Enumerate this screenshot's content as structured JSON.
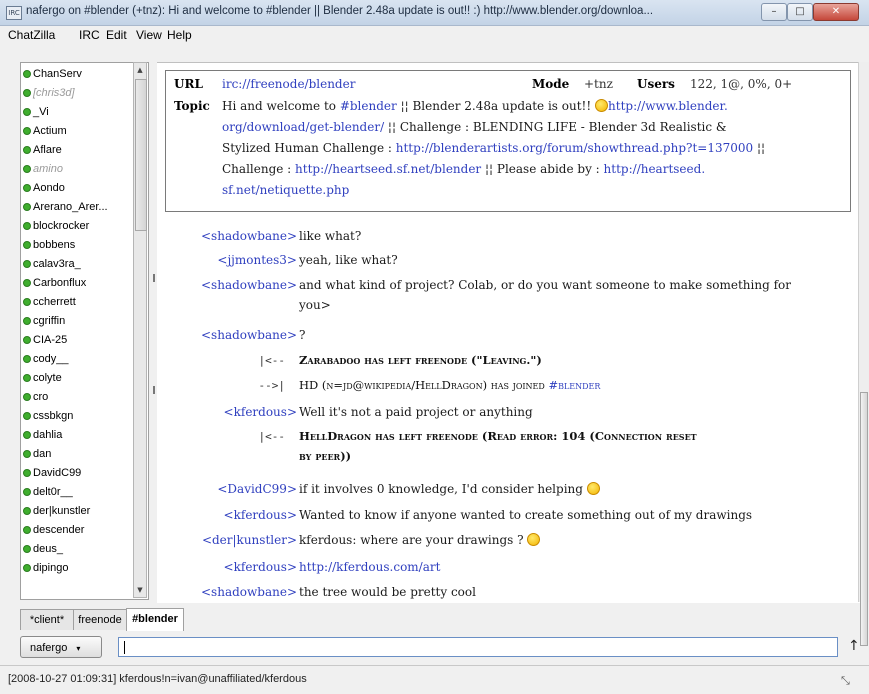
{
  "window": {
    "title": "nafergo on #blender (+tnz): Hi and welcome to #blender || Blender 2.48a update is out!! :) http://www.blender.org/downloa...",
    "app_icon_label": "IRC",
    "minimize": "–",
    "maximize": "□",
    "close": "✕"
  },
  "menu": [
    "ChatZilla",
    "IRC",
    "Edit",
    "View",
    "Help"
  ],
  "users": [
    {
      "name": "ChanServ",
      "away": false
    },
    {
      "name": "[chris3d]",
      "away": true
    },
    {
      "name": "_Vi",
      "away": false
    },
    {
      "name": "Actium",
      "away": false
    },
    {
      "name": "Aflare",
      "away": false
    },
    {
      "name": "amino",
      "away": true
    },
    {
      "name": "Aondo",
      "away": false
    },
    {
      "name": "Arerano_Arer...",
      "away": false
    },
    {
      "name": "blockrocker",
      "away": false
    },
    {
      "name": "bobbens",
      "away": false
    },
    {
      "name": "calav3ra_",
      "away": false
    },
    {
      "name": "Carbonflux",
      "away": false
    },
    {
      "name": "ccherrett",
      "away": false
    },
    {
      "name": "cgriffin",
      "away": false
    },
    {
      "name": "CIA-25",
      "away": false
    },
    {
      "name": "cody__",
      "away": false
    },
    {
      "name": "colyte",
      "away": false
    },
    {
      "name": "cro",
      "away": false
    },
    {
      "name": "cssbkgn",
      "away": false
    },
    {
      "name": "dahlia",
      "away": false
    },
    {
      "name": "dan",
      "away": false
    },
    {
      "name": "DavidC99",
      "away": false
    },
    {
      "name": "delt0r__",
      "away": false
    },
    {
      "name": "der|kunstler",
      "away": false
    },
    {
      "name": "descender",
      "away": false
    },
    {
      "name": "deus_",
      "away": false
    },
    {
      "name": "dipingo",
      "away": false
    }
  ],
  "header": {
    "url_label": "URL",
    "url": "irc://freenode/blender",
    "mode_label": "Mode",
    "mode": "+tnz",
    "users_label": "Users",
    "users": "122, 1@, 0%, 0+",
    "topic_label": "Topic",
    "topic_lines": [
      {
        "parts": [
          [
            "t",
            "Hi and welcome to "
          ],
          [
            "l",
            "#blender"
          ],
          [
            "t",
            " ¦¦ Blender 2.48a update is out!! "
          ],
          [
            "s",
            ""
          ],
          [
            "l",
            "http://www.blender."
          ]
        ]
      },
      {
        "parts": [
          [
            "l",
            "org/download/get-blender/"
          ],
          [
            "t",
            " ¦¦ Challenge : BLENDING LIFE - Blender 3d Realistic &"
          ]
        ]
      },
      {
        "parts": [
          [
            "t",
            "Stylized Human Challenge : "
          ],
          [
            "l",
            "http://blenderartists.org/forum/showthread.php?t=137000"
          ],
          [
            "t",
            " ¦¦"
          ]
        ]
      },
      {
        "parts": [
          [
            "t",
            "Challenge : "
          ],
          [
            "l",
            "http://heartseed.sf.net/blender"
          ],
          [
            "t",
            " ¦¦ Please abide by : "
          ],
          [
            "l",
            "http://heartseed."
          ]
        ]
      },
      {
        "parts": [
          [
            "l",
            "sf.net/netiquette.php"
          ]
        ]
      }
    ]
  },
  "messages": [
    {
      "kind": "msg",
      "nick": "<shadowbane>",
      "lines": [
        [
          [
            "t",
            "like what?"
          ]
        ]
      ]
    },
    {
      "kind": "msg",
      "nick": "<jjmontes3>",
      "lines": [
        [
          [
            "t",
            "yeah,  like what?"
          ]
        ]
      ]
    },
    {
      "kind": "msg",
      "nick": "<shadowbane>",
      "lines": [
        [
          [
            "t",
            "and what kind of project?  Colab, or do you want someone to make something for"
          ]
        ],
        [
          [
            "t",
            "you>"
          ]
        ]
      ]
    },
    {
      "kind": "msg",
      "nick": "<shadowbane>",
      "lines": [
        [
          [
            "t",
            "?"
          ]
        ]
      ]
    },
    {
      "kind": "sys",
      "arrow": "|<--",
      "bold": true,
      "lines": [
        [
          [
            "t",
            "Zarabadoo has left freenode (\"Leaving.\")"
          ]
        ]
      ]
    },
    {
      "kind": "sys",
      "arrow": "-->|",
      "bold": false,
      "lines": [
        [
          [
            "t",
            "HD (n=jd@wikipedia/HellDragon) has joined "
          ],
          [
            "l",
            "#blender"
          ]
        ]
      ]
    },
    {
      "kind": "msg",
      "nick": "<kferdous>",
      "lines": [
        [
          [
            "t",
            "Well it's not a paid project or anything"
          ]
        ]
      ]
    },
    {
      "kind": "sys",
      "arrow": "|<--",
      "bold": true,
      "lines": [
        [
          [
            "t",
            "HellDragon has left freenode (Read error: 104 (Connection reset"
          ]
        ],
        [
          [
            "t",
            "by peer))"
          ]
        ]
      ]
    },
    {
      "kind": "msg",
      "nick": "<DavidC99>",
      "lines": [
        [
          [
            "t",
            "if it involves 0 knowledge, I'd consider helping "
          ],
          [
            "s",
            ""
          ]
        ]
      ]
    },
    {
      "kind": "msg",
      "nick": "<kferdous>",
      "lines": [
        [
          [
            "t",
            "Wanted to know if anyone wanted to create something out of my drawings"
          ]
        ]
      ]
    },
    {
      "kind": "msg",
      "nick": "<der|kunstler>",
      "lines": [
        [
          [
            "t",
            "kferdous: where are your drawings ? "
          ],
          [
            "s",
            ""
          ]
        ]
      ]
    },
    {
      "kind": "msg",
      "nick": "<kferdous>",
      "lines": [
        [
          [
            "l",
            "http://kferdous.com/art"
          ]
        ]
      ]
    },
    {
      "kind": "msg",
      "nick": "<shadowbane>",
      "lines": [
        [
          [
            "t",
            "the tree would be pretty cool"
          ]
        ]
      ]
    }
  ],
  "tabs": [
    {
      "label": "*client*",
      "active": false
    },
    {
      "label": "freenode",
      "active": false
    },
    {
      "label": "#blender",
      "active": true
    }
  ],
  "input": {
    "nick_button": "nafergo",
    "nick_caret": "▾",
    "send_icon": "↑",
    "value": ""
  },
  "status": {
    "text": "[2008-10-27 01:09:31] kferdous!n=ivan@unaffiliated/kferdous",
    "resize_icon": "⤡"
  },
  "colors": {
    "link": "#2f3fbf",
    "online_dot": "#3fae2e",
    "away_text": "#9a9a9a"
  }
}
